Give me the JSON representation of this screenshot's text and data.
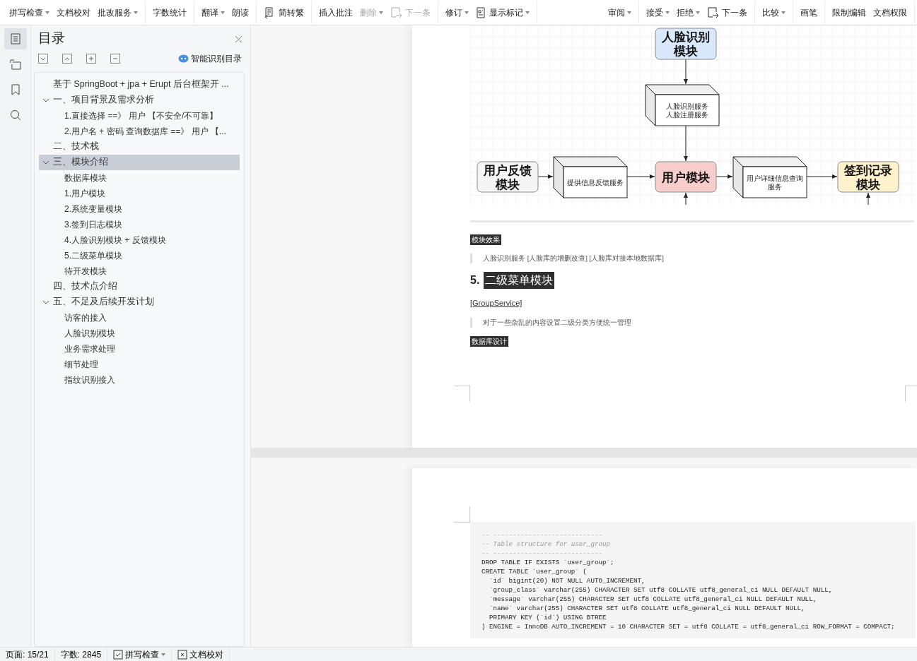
{
  "toolbar": {
    "left_groups": [
      {
        "items": [
          {
            "kind": "text",
            "label": "拼写检查",
            "dropdown": true,
            "disabled": false
          },
          {
            "kind": "text",
            "label": "文档校对",
            "dropdown": false,
            "disabled": false
          },
          {
            "kind": "text",
            "label": "批改服务",
            "dropdown": true,
            "disabled": false
          }
        ]
      },
      {
        "items": [
          {
            "kind": "text",
            "label": "字数统计",
            "dropdown": false,
            "disabled": false
          }
        ]
      },
      {
        "items": [
          {
            "kind": "text",
            "label": "翻译",
            "dropdown": true,
            "disabled": false
          },
          {
            "kind": "text",
            "label": "朗读",
            "dropdown": false,
            "disabled": false
          }
        ]
      },
      {
        "items": [
          {
            "kind": "convert",
            "label": "简转繁",
            "dropdown": false,
            "disabled": false
          }
        ]
      },
      {
        "items": [
          {
            "kind": "text",
            "label": "插入批注",
            "dropdown": false,
            "disabled": false
          },
          {
            "kind": "text",
            "label": "删除",
            "dropdown": true,
            "disabled": true
          },
          {
            "kind": "next",
            "label": "下一条",
            "dropdown": false,
            "disabled": true
          }
        ]
      },
      {
        "items": [
          {
            "kind": "text",
            "label": "修订",
            "dropdown": true,
            "disabled": false
          },
          {
            "kind": "markup",
            "label": "显示标记",
            "dropdown": true,
            "disabled": false
          }
        ]
      }
    ],
    "right_groups": [
      {
        "items": [
          {
            "kind": "text",
            "label": "审阅",
            "dropdown": true,
            "disabled": false
          }
        ]
      },
      {
        "items": [
          {
            "kind": "text",
            "label": "接受",
            "dropdown": true,
            "disabled": false
          },
          {
            "kind": "text",
            "label": "拒绝",
            "dropdown": true,
            "disabled": false
          },
          {
            "kind": "next",
            "label": "下一条",
            "dropdown": false,
            "disabled": false
          }
        ]
      },
      {
        "items": [
          {
            "kind": "text",
            "label": "比较",
            "dropdown": true,
            "disabled": false
          }
        ]
      },
      {
        "items": [
          {
            "kind": "text",
            "label": "画笔",
            "dropdown": false,
            "disabled": false
          }
        ]
      },
      {
        "items": [
          {
            "kind": "text",
            "label": "限制编辑",
            "dropdown": false,
            "disabled": false
          },
          {
            "kind": "text",
            "label": "文档权限",
            "dropdown": false,
            "disabled": false
          }
        ]
      }
    ]
  },
  "rail": [
    {
      "selected": true
    },
    {
      "selected": false
    },
    {
      "selected": false
    },
    {
      "selected": false
    }
  ],
  "toc": {
    "title": "目录",
    "action": "智能识别目录",
    "items": [
      {
        "label": "基于 SpringBoot + jpa + Erupt 后台框架开 ...",
        "selected": false
      },
      {
        "label": "一、项目背景及需求分析",
        "selected": false,
        "expanded": true,
        "children": [
          {
            "label": "1.直接选择 ==》 用户 【不安全/不可靠】",
            "selected": false
          },
          {
            "label": "2.用户名 + 密码 查询数据库 ==》 用户 【...",
            "selected": false
          }
        ]
      },
      {
        "label": "二、技术栈",
        "selected": false
      },
      {
        "label": "三、模块介绍",
        "selected": true,
        "expanded": true,
        "children": [
          {
            "label": "数据库模块",
            "selected": false
          },
          {
            "label": "1.用户模块",
            "selected": false
          },
          {
            "label": "2.系统变量模块",
            "selected": false
          },
          {
            "label": "3.签到日志模块",
            "selected": false
          },
          {
            "label": "4.人脸识别模块 + 反馈模块",
            "selected": false
          },
          {
            "label": "5.二级菜单模块",
            "selected": false
          },
          {
            "label": "待开发模块",
            "selected": false
          }
        ]
      },
      {
        "label": "四、技术点介绍",
        "selected": false
      },
      {
        "label": "五、不足及后续开发计划",
        "selected": false,
        "expanded": true,
        "children": [
          {
            "label": "访客的接入",
            "selected": false
          },
          {
            "label": "人脸识别模块",
            "selected": false
          },
          {
            "label": "业务需求处理",
            "selected": false
          },
          {
            "label": "细节处理",
            "selected": false
          },
          {
            "label": "指纹识别接入",
            "selected": false
          }
        ]
      }
    ]
  },
  "document": {
    "diagram": {
      "nodes": [
        {
          "kind": "module",
          "lines": [
            "人脸识别",
            "模块"
          ],
          "color": "#dae8fc"
        },
        {
          "kind": "service",
          "lines": [
            "人脸识别服务",
            "人脸注册服务"
          ]
        },
        {
          "kind": "module",
          "lines": [
            "用户反馈",
            "模块"
          ],
          "color": "#f5f5f5"
        },
        {
          "kind": "service",
          "lines": [
            "提供信息反馈服务"
          ]
        },
        {
          "kind": "module",
          "lines": [
            "用户模块"
          ],
          "color": "#f8cecc"
        },
        {
          "kind": "service",
          "lines": [
            "用户详细信息查询",
            "服务"
          ]
        },
        {
          "kind": "module",
          "lines": [
            "签到记录",
            "模块"
          ],
          "color": "#fff2cc"
        }
      ]
    },
    "blocks": [
      {
        "kind": "tag",
        "text": "模块效果"
      },
      {
        "kind": "quote",
        "text": "人脸识别服务 [人脸库的增删改查] [人脸库对接本地数据库]"
      },
      {
        "kind": "heading",
        "number": "5.",
        "text": "二级菜单模块"
      },
      {
        "kind": "link",
        "text": "[GroupService]"
      },
      {
        "kind": "quote",
        "text": "对于一些杂乱的内容设置二级分类方便统一管理"
      },
      {
        "kind": "tag",
        "text": "数据库设计"
      }
    ],
    "code": [
      {
        "kind": "comment",
        "text": "-- ----------------------------"
      },
      {
        "kind": "comment",
        "text": "-- Table structure for user_group"
      },
      {
        "kind": "comment",
        "text": "-- ----------------------------"
      },
      {
        "kind": "code",
        "text": "DROP TABLE IF EXISTS `user_group`;"
      },
      {
        "kind": "code",
        "text": "CREATE TABLE `user_group` ("
      },
      {
        "kind": "code",
        "text": "  `id` bigint(20) NOT NULL AUTO_INCREMENT,"
      },
      {
        "kind": "code",
        "text": "  `group_class` varchar(255) CHARACTER SET utf8 COLLATE utf8_general_ci NULL DEFAULT NULL,"
      },
      {
        "kind": "code",
        "text": "  `message` varchar(255) CHARACTER SET utf8 COLLATE utf8_general_ci NULL DEFAULT NULL,"
      },
      {
        "kind": "code",
        "text": "  `name` varchar(255) CHARACTER SET utf8 COLLATE utf8_general_ci NULL DEFAULT NULL,"
      },
      {
        "kind": "code",
        "text": "  PRIMARY KEY (`id`) USING BTREE"
      },
      {
        "kind": "code",
        "text": ") ENGINE = InnoDB AUTO_INCREMENT = 10 CHARACTER SET = utf8 COLLATE = utf8_general_ci ROW_FORMAT = COMPACT;"
      }
    ]
  },
  "status_bar": [
    {
      "kind": "text",
      "label": "页面: 15/21",
      "dropdown": false
    },
    {
      "kind": "text",
      "label": "字数: 2845",
      "dropdown": false
    },
    {
      "kind": "check",
      "label": "拼写检查",
      "dropdown": true
    },
    {
      "kind": "cross",
      "label": "文档校对",
      "dropdown": false
    }
  ]
}
